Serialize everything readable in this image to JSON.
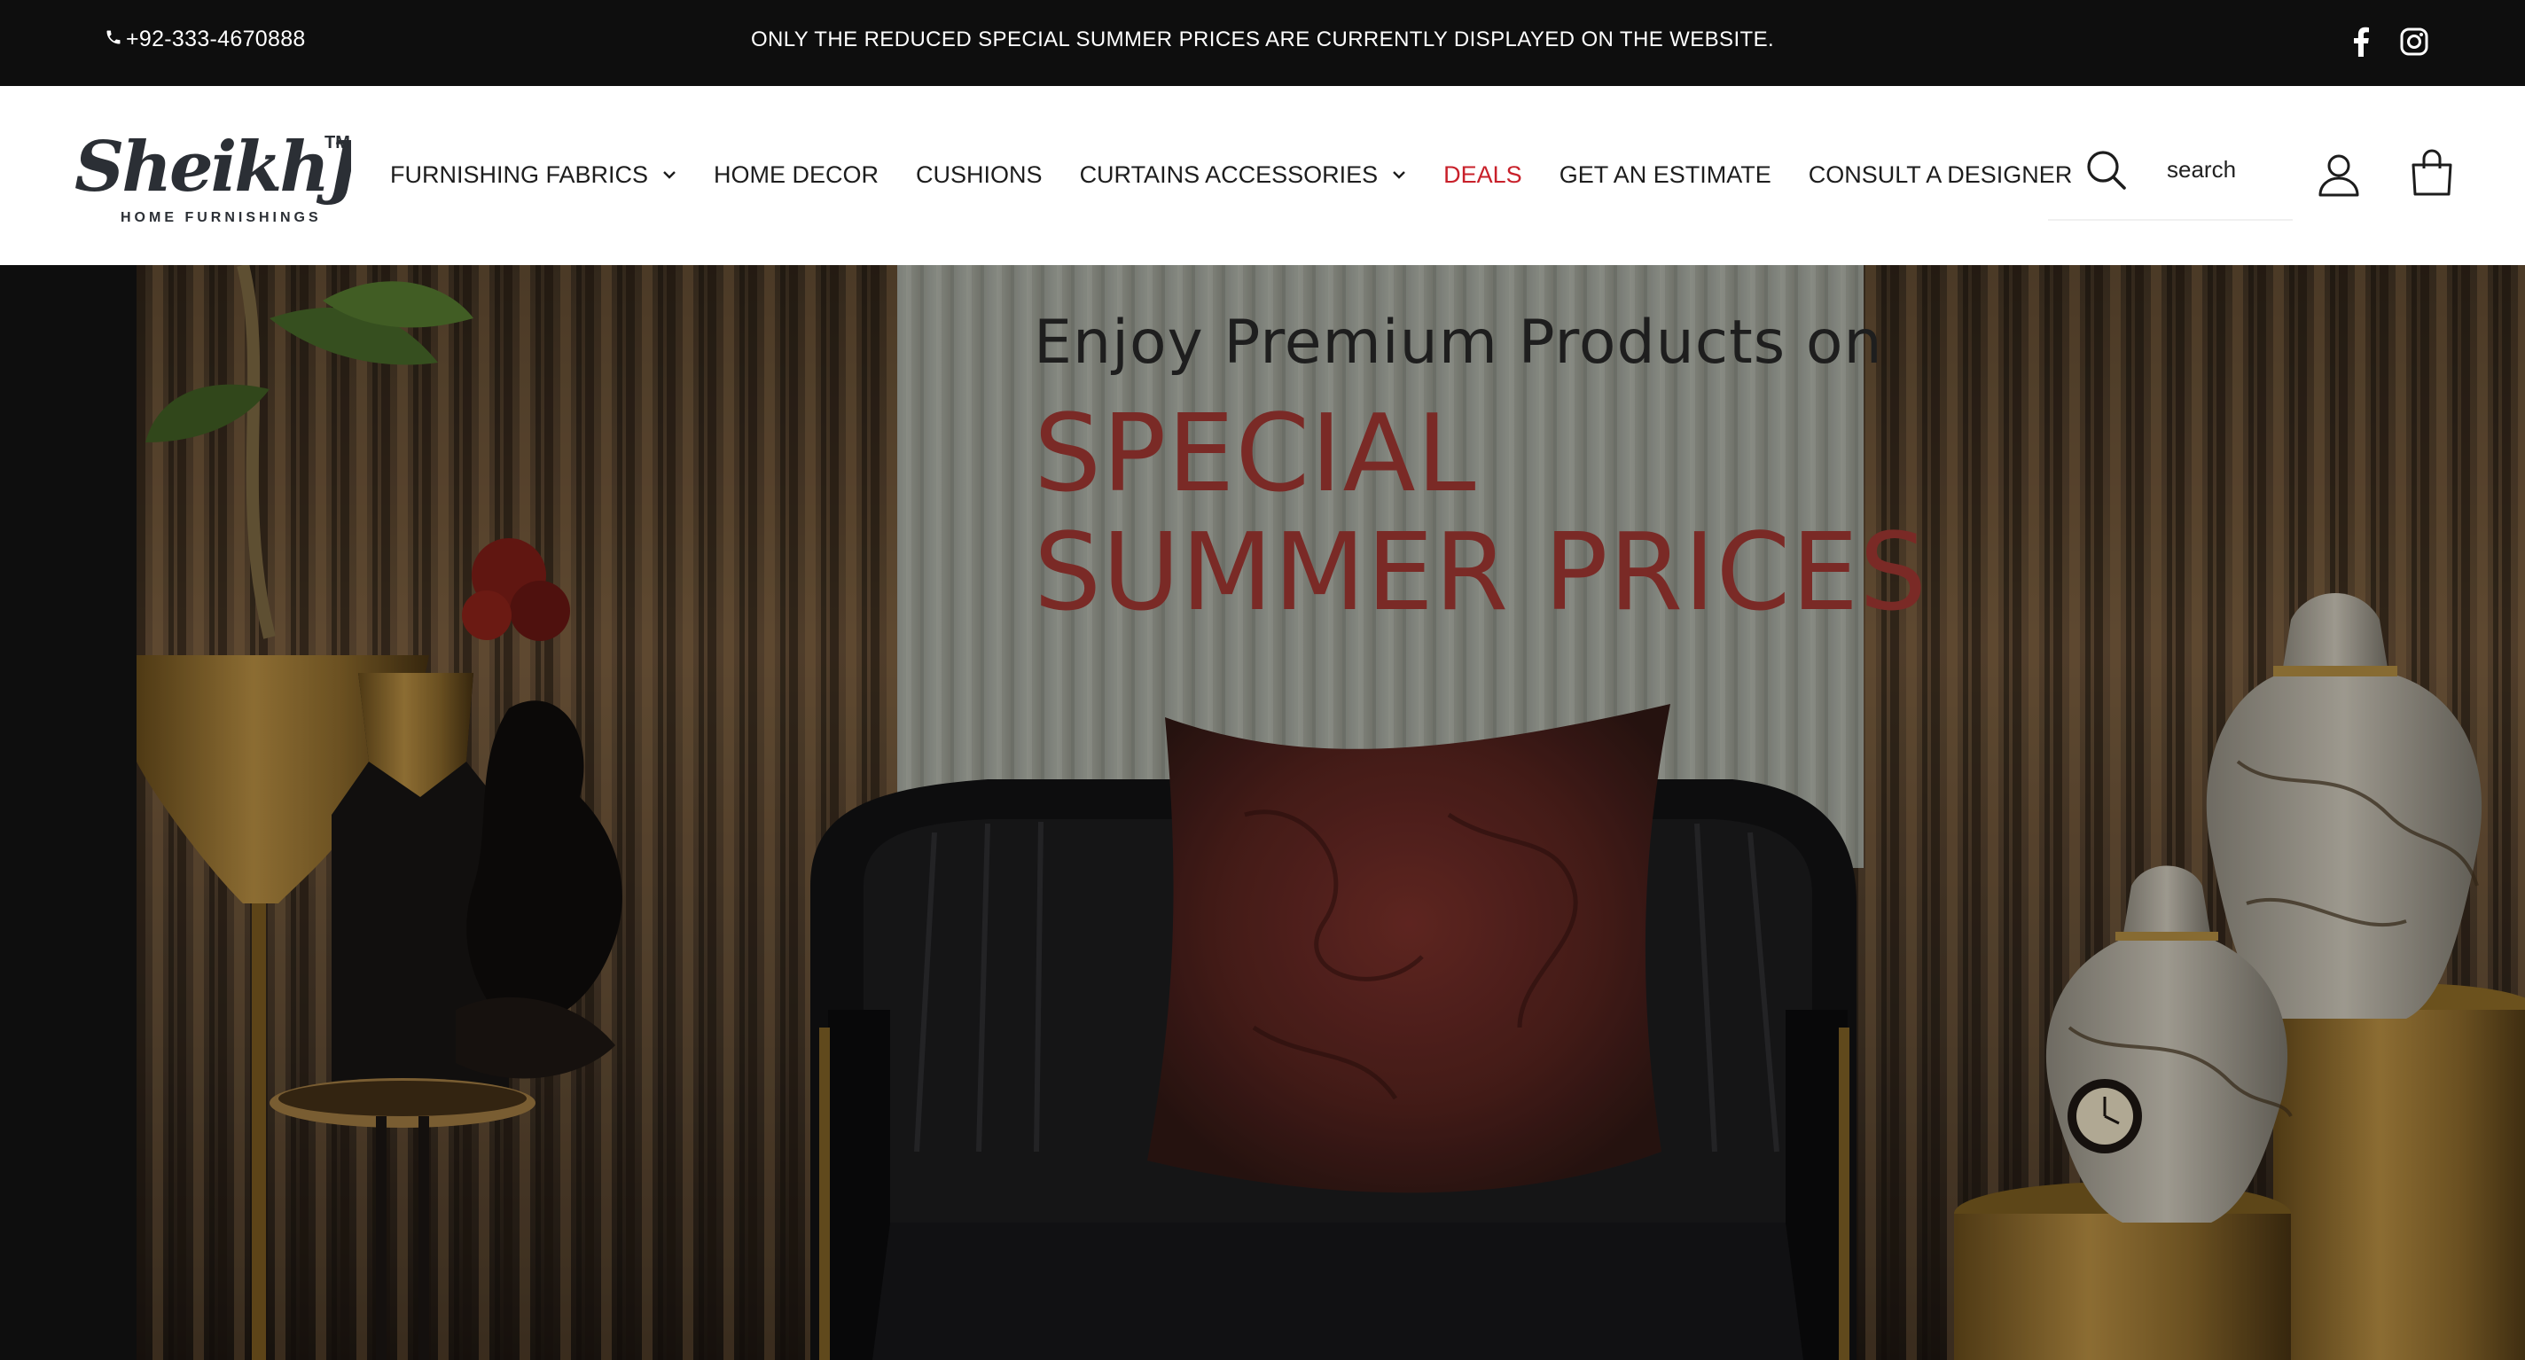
{
  "topbar": {
    "phone": "+92-333-4670888",
    "announcement": "ONLY THE REDUCED SPECIAL SUMMER PRICES ARE CURRENTLY DISPLAYED ON THE WEBSITE.",
    "icons": [
      "phone-icon",
      "facebook-icon",
      "instagram-icon"
    ]
  },
  "header": {
    "logo": {
      "brand": "SheikhJee",
      "trademark": "TM",
      "tagline": "HOME FURNISHINGS"
    },
    "nav": [
      {
        "label": "FURNISHING FABRICS",
        "has_dropdown": true
      },
      {
        "label": "HOME DECOR",
        "has_dropdown": false
      },
      {
        "label": "CUSHIONS",
        "has_dropdown": false
      },
      {
        "label": "CURTAINS ACCESSORIES",
        "has_dropdown": true
      },
      {
        "label": "DEALS",
        "has_dropdown": false,
        "color": "#c8202a"
      },
      {
        "label": "GET AN ESTIMATE",
        "has_dropdown": false
      },
      {
        "label": "CONSULT A DESIGNER",
        "has_dropdown": false
      }
    ],
    "search": {
      "placeholder": "search",
      "icon": "search-icon"
    },
    "icons": [
      "account-icon",
      "cart-icon"
    ]
  },
  "hero": {
    "line1": "Enjoy Premium Products on",
    "line2": "SPECIAL",
    "line3": "SUMMER PRICES"
  },
  "colors": {
    "topbar_bg": "#0e0e0e",
    "header_bg": "#ffffff",
    "deals": "#c8202a",
    "hero_accent": "#7a2a26"
  }
}
